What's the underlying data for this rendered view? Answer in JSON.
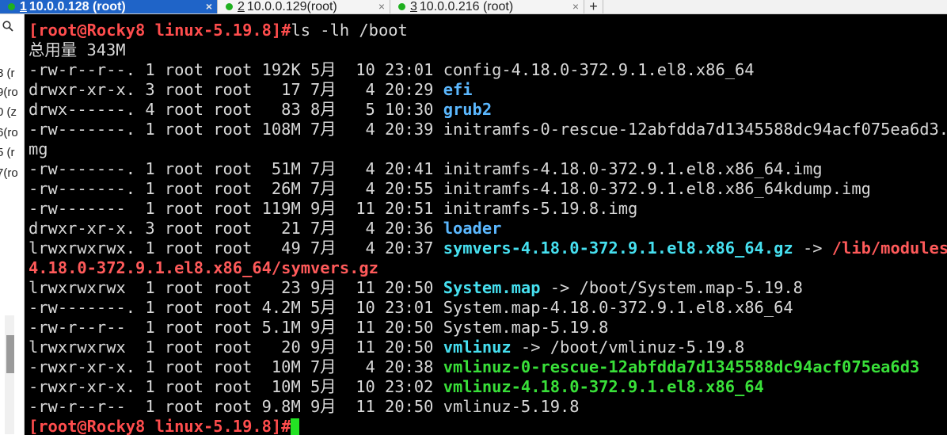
{
  "tabs": [
    {
      "num": "1",
      "label": "10.0.0.128  (root)",
      "active": true
    },
    {
      "num": "2",
      "label": "10.0.0.129(root)",
      "active": false
    },
    {
      "num": "3",
      "label": "10.0.0.216  (root)",
      "active": false
    }
  ],
  "tab_close_glyph": "×",
  "tab_add_glyph": "+",
  "side_fragments": [
    "8  (r",
    "9(ro",
    "0  (z",
    "6(ro",
    "5  (r",
    "7(ro"
  ],
  "terminal": {
    "prompt": "[root@Rocky8 linux-5.19.8]#",
    "command": "ls -lh /boot",
    "total": "总用量 343M",
    "entries": [
      {
        "meta": "-rw-r--r--. 1 root root 192K 5月  10 23:01 ",
        "name": "config-4.18.0-372.9.1.el8.x86_64",
        "kind": "plain"
      },
      {
        "meta": "drwxr-xr-x. 3 root root   17 7月   4 20:29 ",
        "name": "efi",
        "kind": "dir"
      },
      {
        "meta": "drwx------. 4 root root   83 8月   5 10:30 ",
        "name": "grub2",
        "kind": "dir"
      },
      {
        "meta": "-rw-------. 1 root root 108M 7月   4 20:39 ",
        "name": "initramfs-0-rescue-12abfdda7d1345588dc94acf075ea6d3.i",
        "kind": "plain"
      },
      {
        "meta": "",
        "name": "mg",
        "kind": "plain"
      },
      {
        "meta": "-rw-------. 1 root root  51M 7月   4 20:41 ",
        "name": "initramfs-4.18.0-372.9.1.el8.x86_64.img",
        "kind": "plain"
      },
      {
        "meta": "-rw-------. 1 root root  26M 7月   4 20:55 ",
        "name": "initramfs-4.18.0-372.9.1.el8.x86_64kdump.img",
        "kind": "plain"
      },
      {
        "meta": "-rw-------  1 root root 119M 9月  11 20:51 ",
        "name": "initramfs-5.19.8.img",
        "kind": "plain"
      },
      {
        "meta": "drwxr-xr-x. 3 root root   21 7月   4 20:36 ",
        "name": "loader",
        "kind": "dir"
      },
      {
        "meta": "lrwxrwxrwx. 1 root root   49 7月   4 20:37 ",
        "name": "symvers-4.18.0-372.9.1.el8.x86_64.gz",
        "kind": "link",
        "arrow": " -> ",
        "target": "/lib/modules/",
        "target_kind": "broken"
      },
      {
        "meta": "",
        "name": "4.18.0-372.9.1.el8.x86_64/symvers.gz",
        "kind": "broken"
      },
      {
        "meta": "lrwxrwxrwx  1 root root   23 9月  11 20:50 ",
        "name": "System.map",
        "kind": "link",
        "arrow": " -> ",
        "target": "/boot/System.map-5.19.8",
        "target_kind": "plain"
      },
      {
        "meta": "-rw-------. 1 root root 4.2M 5月  10 23:01 ",
        "name": "System.map-4.18.0-372.9.1.el8.x86_64",
        "kind": "plain"
      },
      {
        "meta": "-rw-r--r--  1 root root 5.1M 9月  11 20:50 ",
        "name": "System.map-5.19.8",
        "kind": "plain"
      },
      {
        "meta": "lrwxrwxrwx  1 root root   20 9月  11 20:50 ",
        "name": "vmlinuz",
        "kind": "link",
        "arrow": " -> ",
        "target": "/boot/vmlinuz-5.19.8",
        "target_kind": "plain"
      },
      {
        "meta": "-rwxr-xr-x. 1 root root  10M 7月   4 20:38 ",
        "name": "vmlinuz-0-rescue-12abfdda7d1345588dc94acf075ea6d3",
        "kind": "exec"
      },
      {
        "meta": "-rwxr-xr-x. 1 root root  10M 5月  10 23:02 ",
        "name": "vmlinuz-4.18.0-372.9.1.el8.x86_64",
        "kind": "exec"
      },
      {
        "meta": "-rw-r--r--  1 root root 9.8M 9月  11 20:50 ",
        "name": "vmlinuz-5.19.8",
        "kind": "plain"
      }
    ]
  },
  "colors": {
    "terminal_bg": "#000000",
    "text": "#d8d8d8",
    "prompt": "#ff4d4d",
    "dir": "#5bb8ff",
    "link": "#46e0f0",
    "broken": "#ff5a5a",
    "exec": "#39e039",
    "tab_active": "#1f64c8"
  }
}
